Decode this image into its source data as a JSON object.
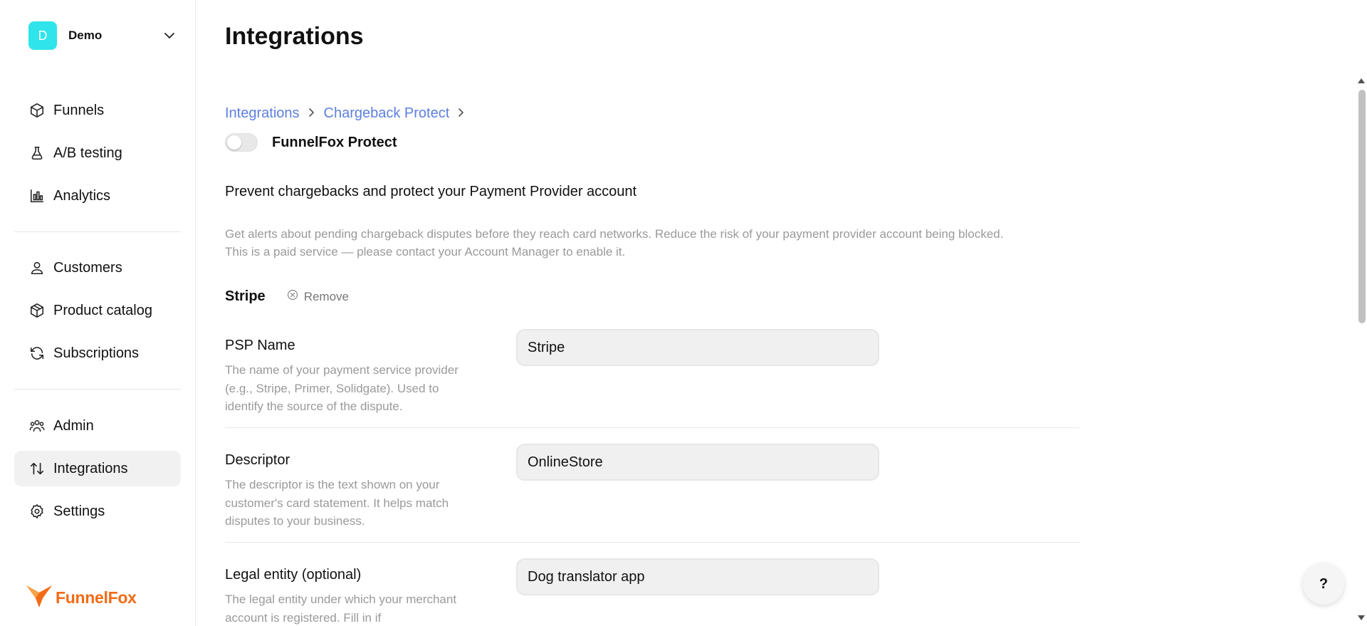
{
  "workspace": {
    "initial": "D",
    "name": "Demo"
  },
  "sidebar": {
    "items": [
      {
        "label": "Funnels",
        "icon": "cube-icon"
      },
      {
        "label": "A/B testing",
        "icon": "flask-icon"
      },
      {
        "label": "Analytics",
        "icon": "bar-chart-icon"
      },
      {
        "label": "Customers",
        "icon": "user-icon"
      },
      {
        "label": "Product catalog",
        "icon": "package-icon"
      },
      {
        "label": "Subscriptions",
        "icon": "refresh-icon"
      },
      {
        "label": "Admin",
        "icon": "admin-users-icon"
      },
      {
        "label": "Integrations",
        "icon": "arrows-up-down-icon",
        "active": true
      },
      {
        "label": "Settings",
        "icon": "gear-icon"
      }
    ]
  },
  "brand": {
    "name": "FunnelFox",
    "color": "#f26b16"
  },
  "page": {
    "title": "Integrations",
    "breadcrumb": [
      "Integrations",
      "Chargeback Protect"
    ],
    "toggle_label": "FunnelFox Protect",
    "toggle_on": false,
    "heading": "Prevent chargebacks and protect your Payment Provider account",
    "description_line1": "Get alerts about pending chargeback disputes before they reach card networks. Reduce the risk of your payment provider account being blocked.",
    "description_line2": "This is a paid service — please contact your Account Manager to enable it.",
    "provider": {
      "name": "Stripe",
      "remove_label": "Remove"
    }
  },
  "fields": {
    "psp": {
      "label": "PSP Name",
      "help": "The name of your payment service provider (e.g., Stripe, Primer, Solidgate). Used to identify the source of the dispute.",
      "value": "Stripe"
    },
    "descriptor": {
      "label": "Descriptor",
      "help": "The descriptor is the text shown on your customer's card statement. It helps match disputes to your business.",
      "value": "OnlineStore"
    },
    "legal": {
      "label": "Legal entity (optional)",
      "help": "The legal entity under which your merchant account is registered. Fill in if",
      "value": "Dog translator app"
    }
  },
  "help_button": "?",
  "colors": {
    "accent_link": "#5c7fe0",
    "avatar": "#2fe4ea",
    "brand": "#f26b16"
  }
}
